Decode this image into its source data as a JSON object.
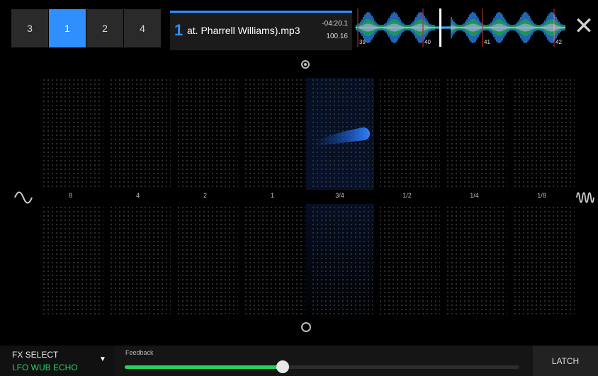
{
  "deck_tabs": [
    {
      "label": "3",
      "active": false
    },
    {
      "label": "1",
      "active": true
    },
    {
      "label": "2",
      "active": false
    },
    {
      "label": "4",
      "active": false
    }
  ],
  "track": {
    "deck_number": "1",
    "title": "at. Pharrell Williams).mp3",
    "remaining_time": "-04:20.1",
    "bpm": "100.16"
  },
  "waveform": {
    "beat_markers": [
      "39",
      "40",
      "41",
      "42"
    ],
    "colors": {
      "high": "#e8f2ff",
      "mid": "#2f8fff",
      "low": "#22d35e"
    }
  },
  "close_icon": "close-icon",
  "xy_pad": {
    "beat_divisions": [
      "8",
      "4",
      "2",
      "1",
      "3/4",
      "1/2",
      "1/4",
      "1/8"
    ],
    "active_division": "3/4",
    "left_icon": "sine-wave-icon",
    "right_icon": "fast-wave-icon"
  },
  "fx": {
    "select_label": "FX SELECT",
    "selected_effect": "LFO WUB ECHO",
    "dropdown_icon": "dropdown-arrow-icon"
  },
  "feedback": {
    "label": "Feedback",
    "value_percent": 40
  },
  "latch": {
    "label": "LATCH"
  },
  "colors": {
    "accent_blue": "#2f8fff",
    "accent_green": "#22d35e",
    "background": "#000000"
  }
}
